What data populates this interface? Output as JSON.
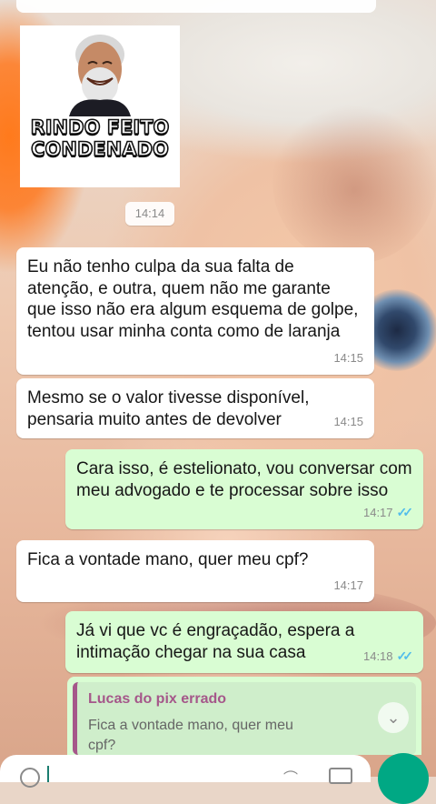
{
  "sticker": {
    "caption_line1": "RINDO FEITO",
    "caption_line2": "CONDENADO",
    "time": "14:14"
  },
  "messages": [
    {
      "direction": "incoming",
      "text": "Eu não tenho culpa da sua falta de atenção, e outra, quem não me garante que isso não era algum esquema de golpe, tentou usar minha conta como de laranja",
      "time": "14:15"
    },
    {
      "direction": "incoming",
      "text": "Mesmo se o valor tivesse disponível, pensaria muito antes de devolver",
      "time": "14:15"
    },
    {
      "direction": "outgoing",
      "text": "Cara isso, é estelionato, vou conversar com meu advogado e te processar sobre isso",
      "time": "14:17",
      "status": "read"
    },
    {
      "direction": "incoming",
      "text": "Fica a vontade mano, quer meu cpf?",
      "time": "14:17"
    },
    {
      "direction": "outgoing",
      "text": "Já vi que vc é engraçadão, espera a intimação chegar na sua casa",
      "time": "14:18",
      "status": "read"
    }
  ],
  "reply_preview": {
    "sender": "Lucas do pix errado",
    "text": "Fica a vontade mano, quer meu cpf?"
  },
  "colors": {
    "incoming_bubble": "#ffffff",
    "outgoing_bubble": "#d9fdd3",
    "read_ticks": "#53bdeb",
    "reply_accent": "#a5578a",
    "send_button": "#00a884"
  }
}
